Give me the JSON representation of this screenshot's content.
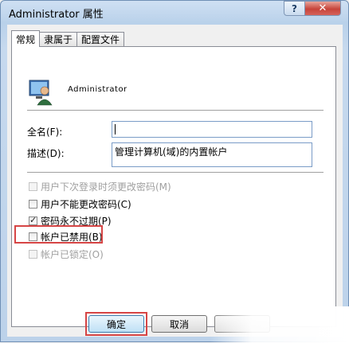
{
  "window": {
    "title": "Administrator 属性",
    "help_button": "?",
    "close_button": "✕"
  },
  "tabs": [
    {
      "label": "常规",
      "active": true
    },
    {
      "label": "隶属于",
      "active": false
    },
    {
      "label": "配置文件",
      "active": false
    }
  ],
  "user": {
    "icon": "user-icon",
    "name": "Administrator"
  },
  "fields": {
    "fullname_label": "全名(F):",
    "fullname_value": "",
    "description_label": "描述(D):",
    "description_value": "管理计算机(域)的内置帐户"
  },
  "checkboxes": [
    {
      "label": "用户下次登录时须更改密码(M)",
      "checked": false,
      "disabled": true
    },
    {
      "label": "用户不能更改密码(C)",
      "checked": false,
      "disabled": false
    },
    {
      "label": "密码永不过期(P)",
      "checked": true,
      "disabled": false
    },
    {
      "label": "帐户已禁用(B)",
      "checked": false,
      "disabled": false
    },
    {
      "label": "帐户已锁定(O)",
      "checked": false,
      "disabled": true
    }
  ],
  "buttons": {
    "ok": "确定",
    "cancel": "取消"
  },
  "colors": {
    "highlight": "#d64545",
    "title_bar": "#b9d1ea",
    "close_button": "#c7443a"
  }
}
